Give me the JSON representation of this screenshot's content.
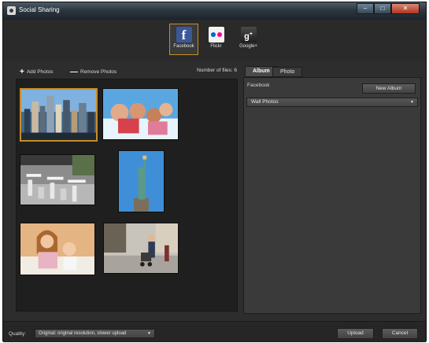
{
  "window": {
    "title": "Social Sharing",
    "controls": {
      "minimize": "–",
      "maximize": "□",
      "close": "✕"
    }
  },
  "services": [
    {
      "label": "Facebook",
      "icon": "facebook-icon",
      "active": true
    },
    {
      "label": "Flickr",
      "icon": "flickr-icon",
      "active": false
    },
    {
      "label": "Google+",
      "icon": "google-plus-icon",
      "active": false
    }
  ],
  "photos_panel": {
    "add_label": "Add Photos",
    "remove_label": "Remove Photos",
    "file_count_label": "Number of files: 6",
    "photos": [
      {
        "subject": "city-skyline",
        "selected": true
      },
      {
        "subject": "people-on-beach",
        "selected": false
      },
      {
        "subject": "cafe-tables",
        "selected": false
      },
      {
        "subject": "statue-of-liberty",
        "selected": false
      },
      {
        "subject": "woman-and-child",
        "selected": false
      },
      {
        "subject": "street-with-stroller",
        "selected": false
      }
    ]
  },
  "details_panel": {
    "tabs": [
      "Album",
      "Photo"
    ],
    "active_tab": "Album",
    "account_label": "Facebook",
    "new_album_label": "New Album",
    "album_value": "Wall Photos"
  },
  "footer": {
    "quality_label": "Quality:",
    "quality_value": "Original: original resolution, slower upload",
    "upload_label": "Upload",
    "cancel_label": "Cancel"
  },
  "colors": {
    "accent": "#c98d24",
    "background": "#2d2d2d",
    "panel": "#3a3a3a"
  }
}
